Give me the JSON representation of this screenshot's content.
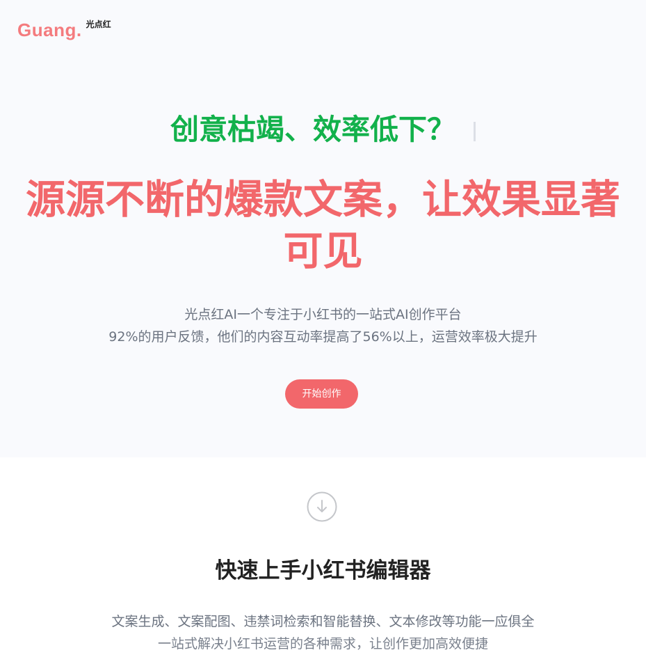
{
  "brand": {
    "logo_text": "Guang.",
    "logo_sub": "光点红",
    "brand_color": "#f47b7e"
  },
  "hero": {
    "tagline": "创意枯竭、效率低下？",
    "tagline_color": "#12b14b",
    "headline": "源源不断的爆款文案，让效果显著可见",
    "headline_color": "#f2676b",
    "desc_line1": "光点红AI一个专注于小红书的一站式AI创作平台",
    "desc_line2": "92%的用户反馈，他们的内容互动率提高了56%以上，运营效率极大提升",
    "cta_label": "开始创作",
    "background": "#f9fafd"
  },
  "scroll_hint": {
    "icon": "arrow-down-circle-icon"
  },
  "feature": {
    "title": "快速上手小红书编辑器",
    "desc_line1": "文案生成、文案配图、违禁词检索和智能替换、文本修改等功能一应俱全",
    "desc_line2": "一站式解决小红书运营的各种需求，让创作更加高效便捷"
  }
}
